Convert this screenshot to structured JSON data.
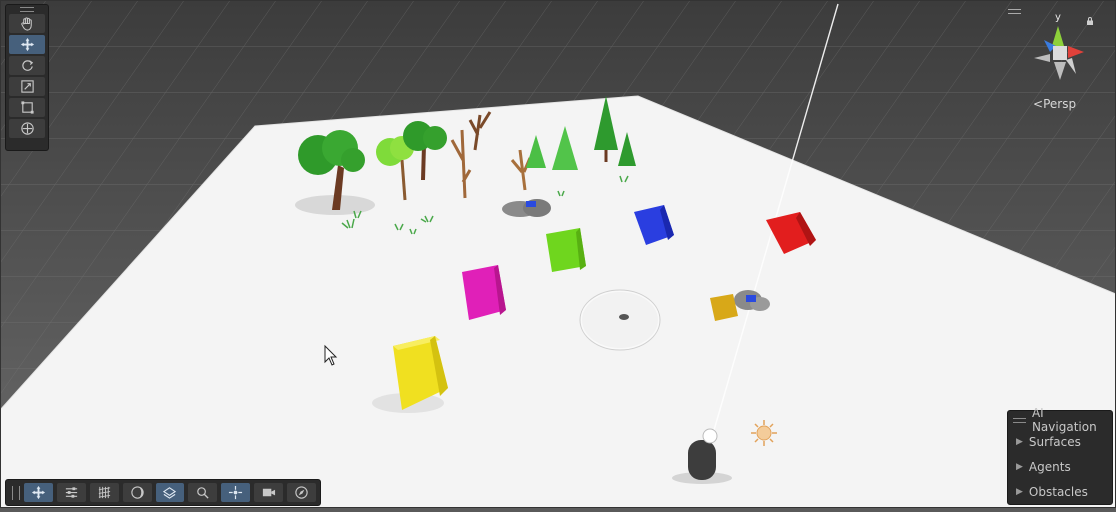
{
  "scene": {
    "tools": [
      {
        "name": "hand-tool",
        "icon": "hand-icon",
        "active": false
      },
      {
        "name": "move-tool",
        "icon": "move-icon",
        "active": true
      },
      {
        "name": "rotate-tool",
        "icon": "rotate-icon",
        "active": false
      },
      {
        "name": "scale-tool",
        "icon": "scale-icon",
        "active": false
      },
      {
        "name": "rect-tool",
        "icon": "rect-icon",
        "active": false
      },
      {
        "name": "transform-tool",
        "icon": "transform-icon",
        "active": false
      }
    ],
    "orientation": {
      "projection_label": "Persp",
      "y_axis_label": "y",
      "axis_colors": {
        "x": "#e0413a",
        "y": "#8dd03a",
        "z": "#3a7ce0"
      }
    },
    "overlay_toolbar": [
      {
        "icon": "move-icon",
        "active": true
      },
      {
        "icon": "sliders-icon",
        "active": false
      },
      {
        "icon": "grid-hatch-icon",
        "active": false
      },
      {
        "icon": "lighting-icon",
        "active": false
      },
      {
        "icon": "layers-icon",
        "active": true
      },
      {
        "icon": "search-icon",
        "active": false
      },
      {
        "icon": "snap-icon",
        "active": true
      },
      {
        "icon": "camera-icon",
        "active": false
      },
      {
        "icon": "compass-icon",
        "active": false
      }
    ],
    "ai_navigation": {
      "title": "AI Navigation",
      "items": [
        {
          "label": "Surfaces"
        },
        {
          "label": "Agents"
        },
        {
          "label": "Obstacles"
        }
      ]
    },
    "objects": {
      "cube_colors": {
        "yellow": "#f0e020",
        "magenta": "#e020b8",
        "green": "#6fd61e",
        "blue": "#2a3ee0",
        "red": "#e21e1e",
        "small_yellow": "#d8a818"
      }
    }
  }
}
